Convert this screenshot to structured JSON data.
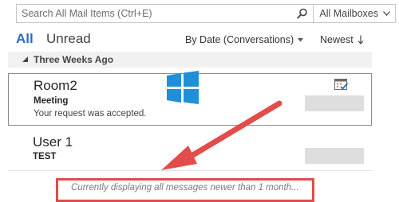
{
  "search": {
    "placeholder": "Search All Mail Items (Ctrl+E)",
    "icon": "search-icon",
    "scope_label": "All Mailboxes",
    "scope_icon": "chevron-down-icon"
  },
  "filters": {
    "all_label": "All",
    "unread_label": "Unread",
    "sort_by_label": "By Date (Conversations)",
    "sort_order_label": "Newest"
  },
  "group": {
    "label": "Three Weeks Ago"
  },
  "messages": [
    {
      "sender": "Room2",
      "subject": "Meeting",
      "preview": "Your request was accepted.",
      "icon": "meeting-accepted-icon"
    },
    {
      "sender": "User 1",
      "subject": "TEST"
    }
  ],
  "status": {
    "text": "Currently displaying all messages newer than 1 month..."
  },
  "colors": {
    "accent": "#2b6cc4",
    "annotation": "#e24c4b",
    "logo": "#1e90d8"
  }
}
